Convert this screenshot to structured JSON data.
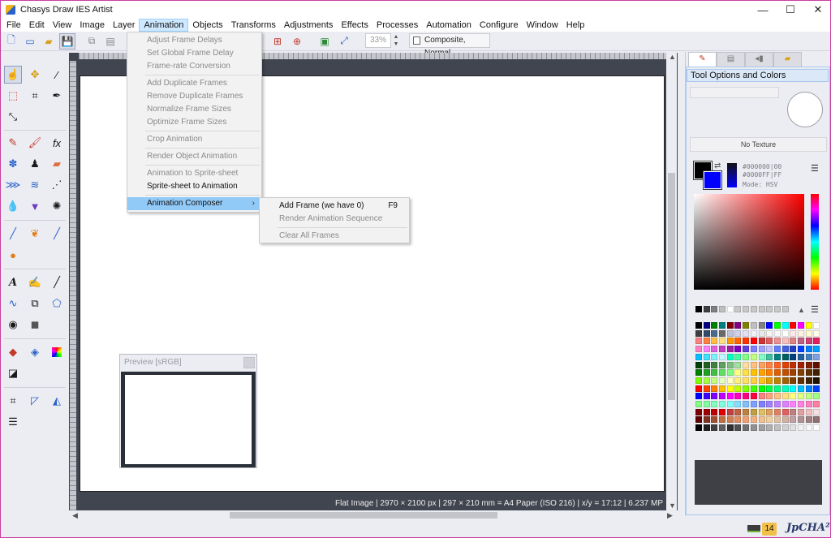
{
  "window": {
    "title": "Chasys Draw IES Artist",
    "minimize": "—",
    "maximize": "☐",
    "close": "✕"
  },
  "menubar": [
    "File",
    "Edit",
    "View",
    "Image",
    "Layer",
    "Animation",
    "Objects",
    "Transforms",
    "Adjustments",
    "Effects",
    "Processes",
    "Automation",
    "Configure",
    "Window",
    "Help"
  ],
  "menubar_active": "Animation",
  "toolbar": {
    "zoom": "33%",
    "blend_mode": "Composite, Normal"
  },
  "animation_menu": [
    {
      "label": "Adjust Frame Delays",
      "enabled": false
    },
    {
      "label": "Set Global Frame Delay",
      "enabled": false
    },
    {
      "label": "Frame-rate Conversion",
      "enabled": false
    },
    {
      "sep": true
    },
    {
      "label": "Add Duplicate Frames",
      "enabled": false
    },
    {
      "label": "Remove Duplicate Frames",
      "enabled": false
    },
    {
      "label": "Normalize Frame Sizes",
      "enabled": false
    },
    {
      "label": "Optimize Frame Sizes",
      "enabled": false
    },
    {
      "sep": true
    },
    {
      "label": "Crop Animation",
      "enabled": false
    },
    {
      "sep": true
    },
    {
      "label": "Render Object Animation",
      "enabled": false
    },
    {
      "sep": true
    },
    {
      "label": "Animation to Sprite-sheet",
      "enabled": false
    },
    {
      "label": "Sprite-sheet to Animation",
      "enabled": true
    },
    {
      "sep": true
    },
    {
      "label": "Animation Composer",
      "enabled": true,
      "submenu": true,
      "hover": true
    }
  ],
  "composer_submenu": [
    {
      "label": "Add Frame (we have 0)",
      "enabled": true,
      "shortcut": "F9"
    },
    {
      "label": "Render Animation Sequence",
      "enabled": false
    },
    {
      "sep": true
    },
    {
      "label": "Clear All Frames",
      "enabled": false
    }
  ],
  "preview": {
    "title": "Preview [sRGB]"
  },
  "status": {
    "info": "Flat Image | 2970 × 2100 px | 297 × 210 mm = A4 Paper (ISO 216) | x/y = 17:12 | 6.237 MP"
  },
  "right_panel": {
    "title": "Tool Options and Colors",
    "texture": "No Texture",
    "fg_code": "#000000|00",
    "bg_code": "#0000FF|FF",
    "mode": "Mode: HSV",
    "colors": {
      "fg": "#000000",
      "bg": "#0000ff"
    }
  },
  "bottom": {
    "badge_count": "14",
    "brand": "JpCHA²"
  },
  "palette": {
    "grays": [
      "#000000",
      "#3f3f3f",
      "#7f7f7f",
      "#bfbfbf",
      "#ffffff",
      "#c8c8c8",
      "#c8c8c8",
      "#c8c8c8",
      "#c8c8c8",
      "#c8c8c8",
      "#c8c8c8",
      "#c8c8c8"
    ],
    "rows": [
      [
        "#000000",
        "#000080",
        "#008000",
        "#008080",
        "#800000",
        "#800080",
        "#808000",
        "#c0c0c0",
        "#808080",
        "#0000ff",
        "#00ff00",
        "#00ffff",
        "#ff0000",
        "#ff00ff",
        "#ffff00",
        "#ffffff"
      ],
      [
        "#3f3f3f",
        "#334a6a",
        "#4a6a8a",
        "#6a6a6a",
        "#c0c0d8",
        "#d0d0e8",
        "#e0e0f0",
        "#f0f0f8",
        "#e8e8e8",
        "#f4f4f4",
        "#f8f8f8",
        "#ffffff",
        "#ffe8e8",
        "#fff0e0",
        "#fff8d0",
        "#ffffe8"
      ],
      [
        "#ff8080",
        "#ff8040",
        "#ffc040",
        "#ffe080",
        "#ff9900",
        "#ff6600",
        "#ff3300",
        "#ff0000",
        "#cc3333",
        "#e06060",
        "#f09090",
        "#f8c0c0",
        "#e08080",
        "#c06080",
        "#d04070",
        "#e02060"
      ],
      [
        "#ff80c0",
        "#ff80ff",
        "#e060e0",
        "#c040c0",
        "#a020a0",
        "#8000c0",
        "#6040e0",
        "#8080ff",
        "#a0a0ff",
        "#c0c0ff",
        "#6080ff",
        "#4060e0",
        "#2040c0",
        "#0040ff",
        "#0080ff",
        "#00a0ff"
      ],
      [
        "#00c0ff",
        "#40e0ff",
        "#80f0ff",
        "#c0f8ff",
        "#00ffc0",
        "#40ffa0",
        "#80ff80",
        "#c0ff80",
        "#80ffc0",
        "#40c0a0",
        "#008080",
        "#006060",
        "#004080",
        "#2060a0",
        "#4080c0",
        "#80a0e0"
      ],
      [
        "#004000",
        "#206020",
        "#408040",
        "#60a060",
        "#80c080",
        "#a0e0a0",
        "#ffe0a0",
        "#ffc080",
        "#ffa060",
        "#ff8040",
        "#ff6020",
        "#e04000",
        "#c03000",
        "#a02000",
        "#802000",
        "#601000"
      ],
      [
        "#008000",
        "#20a020",
        "#40c040",
        "#60e060",
        "#80ff80",
        "#ffff80",
        "#ffe040",
        "#ffc000",
        "#ffa000",
        "#ff8000",
        "#e06000",
        "#c05000",
        "#a04000",
        "#804000",
        "#603000",
        "#402000"
      ],
      [
        "#80ff00",
        "#a0ff40",
        "#c0ff80",
        "#e0ffc0",
        "#ffffc0",
        "#fff080",
        "#ffe060",
        "#ffd040",
        "#ffc020",
        "#e0a000",
        "#c08000",
        "#a06000",
        "#804000",
        "#603000",
        "#402000",
        "#201000"
      ],
      [
        "#ff0000",
        "#ff4000",
        "#ff8000",
        "#ffc000",
        "#ffff00",
        "#c0ff00",
        "#80ff00",
        "#40ff00",
        "#00ff00",
        "#00ff40",
        "#00ff80",
        "#00ffc0",
        "#00ffff",
        "#00c0ff",
        "#0080ff",
        "#0040ff"
      ],
      [
        "#0000ff",
        "#4000ff",
        "#8000ff",
        "#c000ff",
        "#ff00ff",
        "#ff00c0",
        "#ff0080",
        "#ff0040",
        "#ff8080",
        "#ffa080",
        "#ffc080",
        "#ffe080",
        "#ffff80",
        "#e0ff80",
        "#c0ff80",
        "#a0ff80"
      ],
      [
        "#80ff80",
        "#80ffa0",
        "#80ffc0",
        "#80ffe0",
        "#80ffff",
        "#80e0ff",
        "#80c0ff",
        "#80a0ff",
        "#8080ff",
        "#a080ff",
        "#c080ff",
        "#e080ff",
        "#ff80ff",
        "#ff80e0",
        "#ff80c0",
        "#ff80a0"
      ],
      [
        "#800000",
        "#a00000",
        "#c00000",
        "#e00000",
        "#c04040",
        "#c06040",
        "#c08040",
        "#c0a040",
        "#e0c060",
        "#e0a060",
        "#e08060",
        "#e06060",
        "#c08080",
        "#e0a0a0",
        "#f0c0c0",
        "#f8e0e0"
      ],
      [
        "#600000",
        "#803020",
        "#a05030",
        "#c07040",
        "#d08050",
        "#e09060",
        "#f0a070",
        "#f0b080",
        "#f0c090",
        "#f0d0a0",
        "#e0c0a0",
        "#d0b0a0",
        "#c0a0a0",
        "#b09090",
        "#a08080",
        "#907070"
      ],
      [
        "#000000",
        "#202020",
        "#404040",
        "#606060",
        "#303030",
        "#505050",
        "#707070",
        "#909090",
        "#a0a0a0",
        "#b0b0b0",
        "#c0c0c0",
        "#d0d0d0",
        "#e0e0e0",
        "#f0f0f0",
        "#f8f8f8",
        "#ffffff"
      ]
    ]
  }
}
